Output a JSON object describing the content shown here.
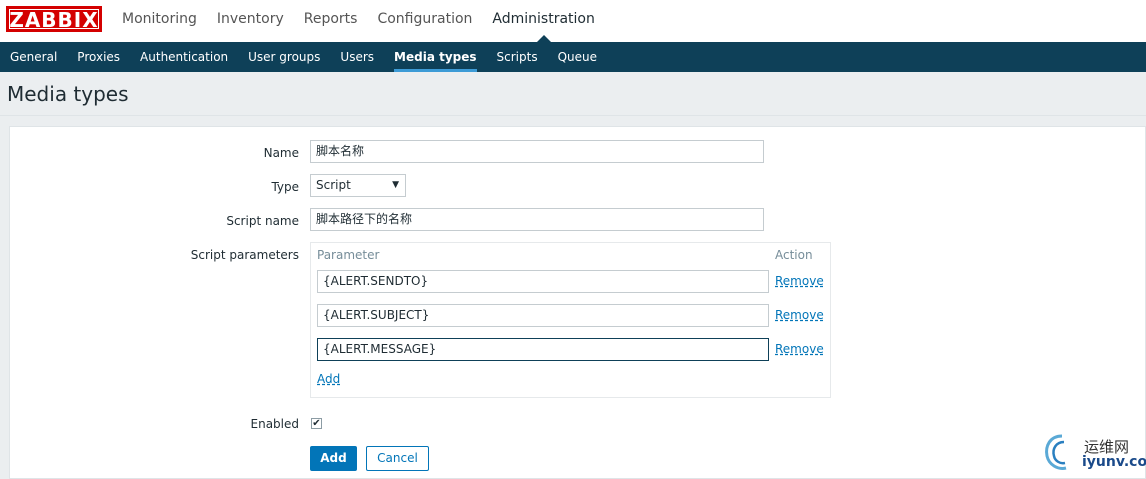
{
  "logo": "ZABBIX",
  "main_nav": [
    {
      "label": "Monitoring",
      "active": false
    },
    {
      "label": "Inventory",
      "active": false
    },
    {
      "label": "Reports",
      "active": false
    },
    {
      "label": "Configuration",
      "active": false
    },
    {
      "label": "Administration",
      "active": true
    }
  ],
  "sub_nav": [
    {
      "label": "General",
      "active": false
    },
    {
      "label": "Proxies",
      "active": false
    },
    {
      "label": "Authentication",
      "active": false
    },
    {
      "label": "User groups",
      "active": false
    },
    {
      "label": "Users",
      "active": false
    },
    {
      "label": "Media types",
      "active": true
    },
    {
      "label": "Scripts",
      "active": false
    },
    {
      "label": "Queue",
      "active": false
    }
  ],
  "page_title": "Media types",
  "form": {
    "name_label": "Name",
    "name_value": "脚本名称",
    "type_label": "Type",
    "type_value": "Script",
    "script_name_label": "Script name",
    "script_name_value": "脚本路径下的名称",
    "script_params_label": "Script parameters",
    "params_header_parameter": "Parameter",
    "params_header_action": "Action",
    "params": [
      {
        "value": "{ALERT.SENDTO}",
        "action": "Remove"
      },
      {
        "value": "{ALERT.SUBJECT}",
        "action": "Remove"
      },
      {
        "value": "{ALERT.MESSAGE}",
        "action": "Remove"
      }
    ],
    "add_param_label": "Add",
    "enabled_label": "Enabled",
    "enabled_checked": true,
    "add_button": "Add",
    "cancel_button": "Cancel"
  },
  "watermark": {
    "cn": "运维网",
    "en": "iyunv.com"
  },
  "colors": {
    "brand_red": "#d40000",
    "nav_dark": "#0e4058",
    "link_blue": "#0275b8"
  }
}
